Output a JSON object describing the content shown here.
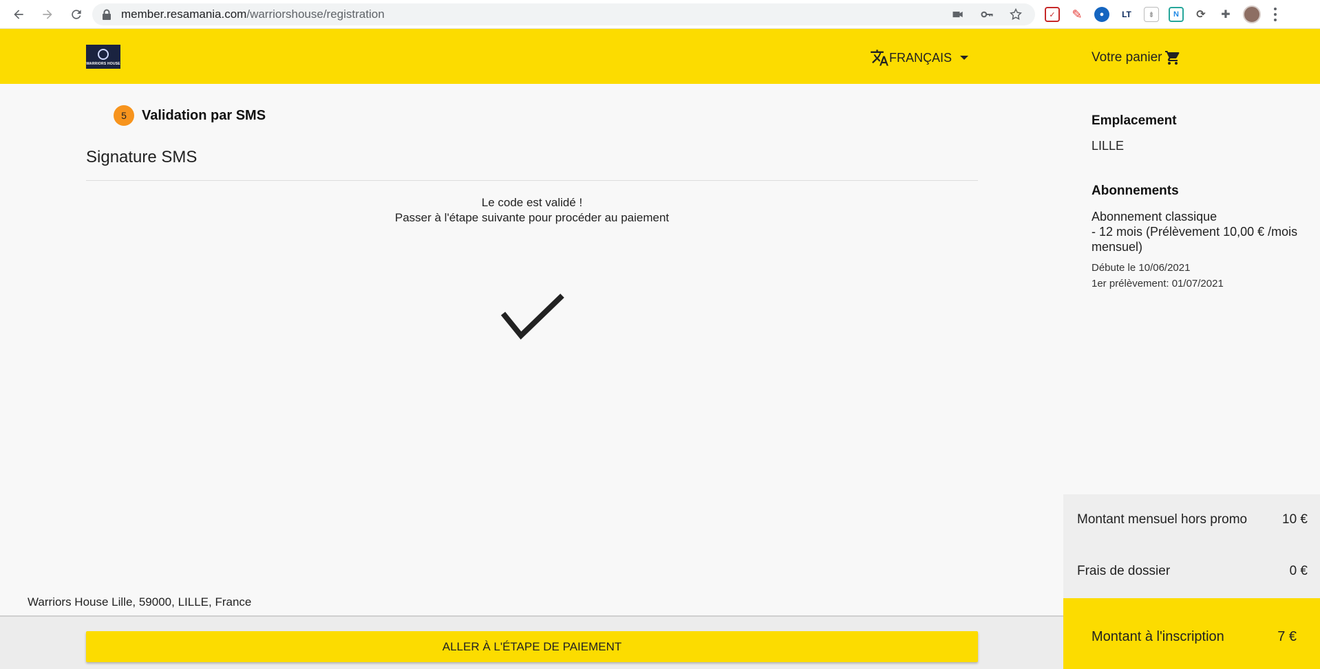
{
  "browser": {
    "url_host": "member.resamania.com",
    "url_path": "/warriorshouse/registration"
  },
  "header": {
    "logo_text": "WARRIORS HOUSE",
    "language": "FRANÇAIS",
    "cart_label": "Votre panier"
  },
  "main": {
    "step_number": "5",
    "step_label": "Validation par SMS",
    "section_title": "Signature SMS",
    "message_line1": "Le code est validé !",
    "message_line2": "Passer à l'étape suivante pour procéder au paiement",
    "address": "Warriors House Lille, 59000, LILLE, France",
    "cta_label": "ALLER À L'ÉTAPE DE PAIEMENT"
  },
  "sidebar": {
    "location_heading": "Emplacement",
    "location_value": "LILLE",
    "subscriptions_heading": "Abonnements",
    "subscription_line1": "Abonnement classique",
    "subscription_line2": "- 12 mois (Prélèvement 10,00 € /mois",
    "subscription_line3": "mensuel)",
    "start_date": "Débute le 10/06/2021",
    "first_debit": "1er prélèvement: 01/07/2021"
  },
  "summary": {
    "monthly_label": "Montant mensuel hors promo",
    "monthly_value": "10 €",
    "fees_label": "Frais de dossier",
    "fees_value": "0 €",
    "total_label": "Montant à l'inscription",
    "total_value": "7 €"
  },
  "colors": {
    "brand_yellow": "#fcdc00",
    "step_orange": "#f7941d"
  }
}
